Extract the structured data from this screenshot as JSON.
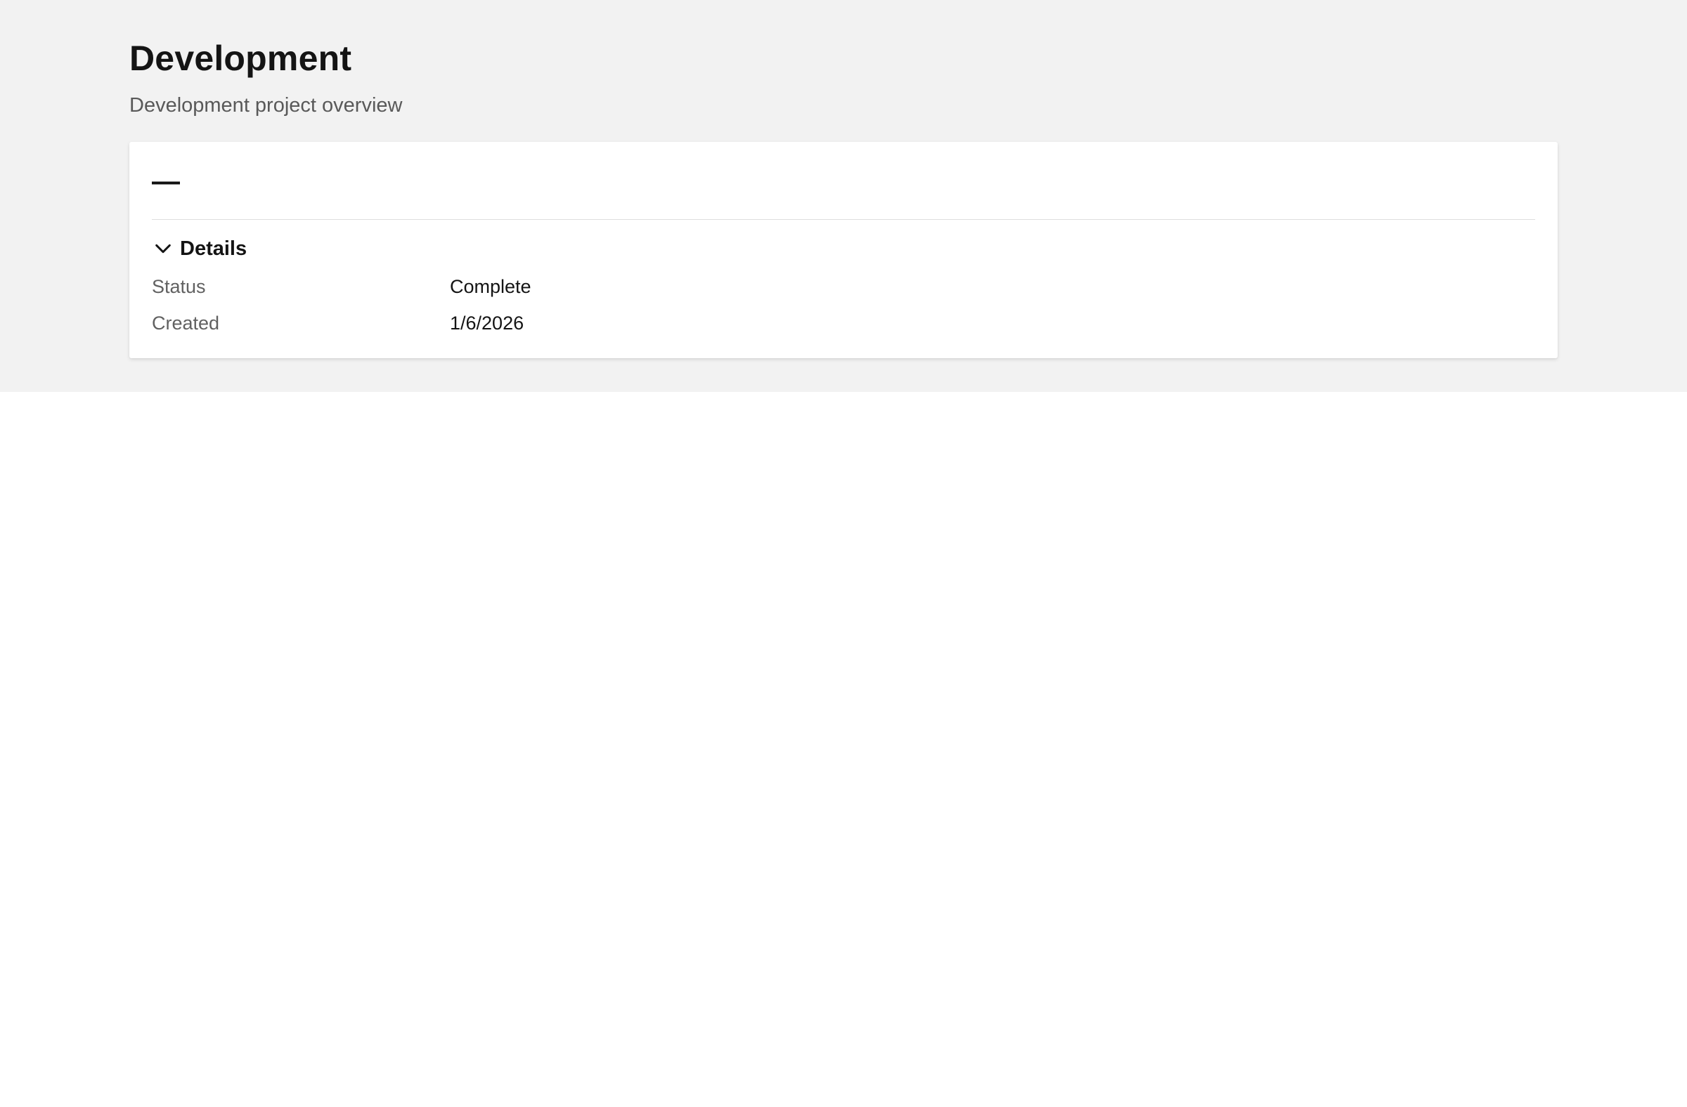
{
  "page": {
    "title": "Development",
    "subtitle": "Development project overview"
  },
  "card": {
    "heading": "—",
    "section": {
      "label": "Details",
      "expanded": true,
      "toggle_icon": "chevron-down-icon"
    },
    "details": [
      {
        "label": "Status",
        "value": "Complete"
      },
      {
        "label": "Created",
        "value": "1/6/2026"
      }
    ]
  },
  "colors": {
    "hero_background": "#f2f2f2",
    "card_background": "#ffffff",
    "title_text": "#141414",
    "muted_text": "#595959"
  }
}
